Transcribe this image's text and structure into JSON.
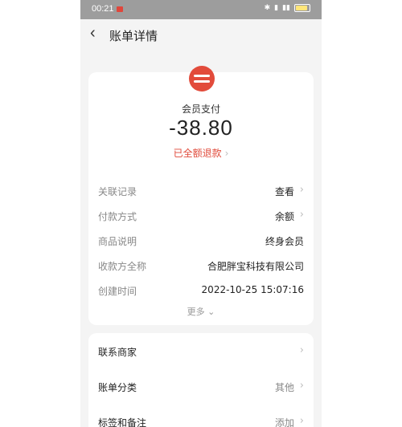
{
  "status_bar": {
    "time": "00:21",
    "battery_label": "battery"
  },
  "nav": {
    "back_glyph": "‹",
    "title": "账单详情"
  },
  "bill": {
    "merchant": "会员支付",
    "amount": "-38.80",
    "refund_status": "已全额退款",
    "details": [
      {
        "label": "关联记录",
        "value": "查看",
        "arrow": true
      },
      {
        "label": "付款方式",
        "value": "余额",
        "arrow": true
      },
      {
        "label": "商品说明",
        "value": "终身会员",
        "arrow": false
      },
      {
        "label": "收款方全称",
        "value": "合肥胖宝科技有限公司",
        "arrow": false
      },
      {
        "label": "创建时间",
        "value": "2022-10-25 15:07:16",
        "arrow": false
      }
    ],
    "more_label": "更多"
  },
  "actions": [
    {
      "label": "联系商家",
      "value": ""
    },
    {
      "label": "账单分类",
      "value": "其他"
    },
    {
      "label": "标签和备注",
      "value": "添加"
    }
  ],
  "colors": {
    "accent": "#e04a3a",
    "logo": "#e24b3b",
    "status_bar": "#9d9d9d"
  }
}
